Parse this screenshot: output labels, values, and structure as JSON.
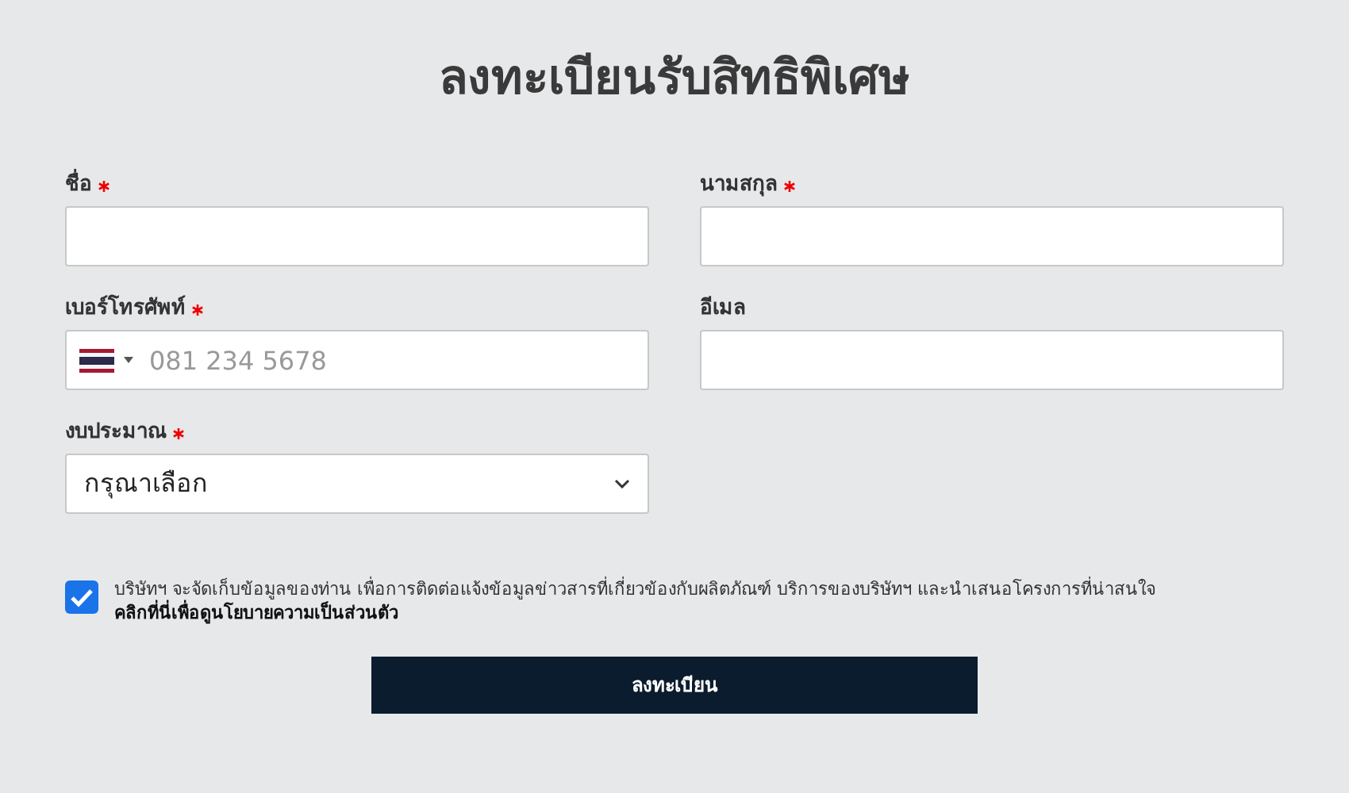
{
  "title": "ลงทะเบียนรับสิทธิพิเศษ",
  "fields": [
    {
      "kind": "text",
      "label": "ชื่อ",
      "required": true
    },
    {
      "kind": "text",
      "label": "นามสกุล",
      "required": true
    },
    {
      "kind": "phone",
      "label": "เบอร์โทรศัพท์",
      "required": true,
      "placeholder": "081 234 5678"
    },
    {
      "kind": "text",
      "label": "อีเมล",
      "required": false
    },
    {
      "kind": "select",
      "label": "งบประมาณ",
      "required": true,
      "value": "กรุณาเลือก"
    }
  ],
  "consent": {
    "checked": true,
    "text": "บริษัทฯ จะจัดเก็บข้อมูลของท่าน เพื่อการติดต่อแจ้งข้อมูลข่าวสารที่เกี่ยวข้องกับผลิตภัณฑ์ บริการของบริษัทฯ และนำเสนอโครงการที่น่าสนใจ",
    "link": "คลิกที่นี่เพื่อดูนโยบายความเป็นส่วนตัว"
  },
  "submit": "ลงทะเบียน"
}
